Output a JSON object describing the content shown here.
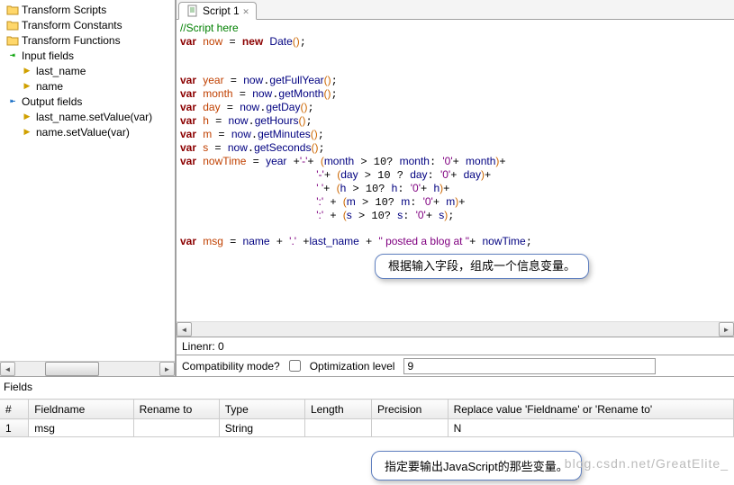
{
  "sidebar": {
    "items": [
      {
        "label": "Transform Scripts",
        "icon": "folder",
        "indent": 0,
        "interact": true
      },
      {
        "label": "Transform Constants",
        "icon": "folder",
        "indent": 0,
        "interact": true
      },
      {
        "label": "Transform Functions",
        "icon": "folder",
        "indent": 0,
        "interact": true
      },
      {
        "label": "Input fields",
        "icon": "in",
        "indent": 0,
        "interact": true
      },
      {
        "label": "last_name",
        "icon": "arrow",
        "indent": 1,
        "interact": true
      },
      {
        "label": "name",
        "icon": "arrow",
        "indent": 1,
        "interact": true
      },
      {
        "label": "Output fields",
        "icon": "out",
        "indent": 0,
        "interact": true
      },
      {
        "label": "last_name.setValue(var)",
        "icon": "arrow",
        "indent": 1,
        "interact": true
      },
      {
        "label": "name.setValue(var)",
        "icon": "arrow",
        "indent": 1,
        "interact": true
      }
    ]
  },
  "tab": {
    "label": "Script 1",
    "close": "✕"
  },
  "status": {
    "linenr": "Linenr: 0"
  },
  "compat": {
    "label": "Compatibility mode?",
    "optlabel": "Optimization level",
    "optvalue": "9"
  },
  "fields": {
    "title": "Fields",
    "headers": [
      "#",
      "Fieldname",
      "Rename to",
      "Type",
      "Length",
      "Precision",
      "Replace value 'Fieldname' or 'Rename to'"
    ],
    "row": {
      "num": "1",
      "fieldname": "msg",
      "rename": "",
      "type": "String",
      "length": "",
      "precision": "",
      "replace": "N"
    }
  },
  "callouts": {
    "c1": "根据输入字段，组成一个信息变量。",
    "c2": "指定要输出JavaScript的那些变量。"
  },
  "watermark": "blog.csdn.net/GreatElite_"
}
